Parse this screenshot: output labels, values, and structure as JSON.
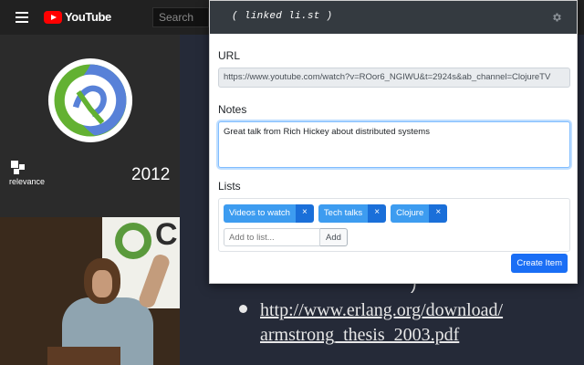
{
  "youtube": {
    "logo_text": "YouTube",
    "search_placeholder": "Search",
    "slide": {
      "year": "2012",
      "company": "relevance",
      "fragment": ")",
      "link_line1": "http://www.erlang.org/download/",
      "link_line2": "armstrong_thesis_2003.pdf"
    },
    "banner_text": "C"
  },
  "popup": {
    "title": "( linked li.st )",
    "settings_icon": "gear-icon",
    "url": {
      "label": "URL",
      "value": "https://www.youtube.com/watch?v=ROor6_NGIWU&t=2924s&ab_channel=ClojureTV"
    },
    "notes": {
      "label": "Notes",
      "value": "Great talk from Rich Hickey about distributed systems"
    },
    "lists": {
      "label": "Lists",
      "items": [
        {
          "label": "Videos to watch",
          "remove": "×"
        },
        {
          "label": "Tech talks",
          "remove": "×"
        },
        {
          "label": "Clojure",
          "remove": "×"
        }
      ],
      "add_placeholder": "Add to list...",
      "add_button": "Add"
    },
    "create_button": "Create Item"
  },
  "colors": {
    "header_bg": "#343a40",
    "chip_bg": "#3d9cf0",
    "chip_remove_bg": "#1a6fd9",
    "primary_button": "#1a6ef5",
    "youtube_red": "#ff0000"
  }
}
